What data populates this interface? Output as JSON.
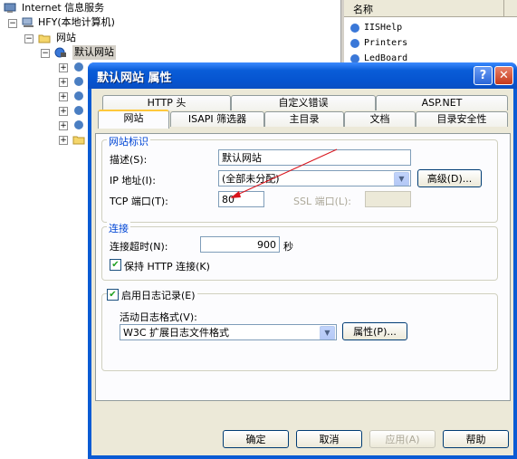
{
  "tree": {
    "root_label": "Internet 信息服务",
    "computer_label": "HFY(本地计算机)",
    "sites_label": "网站",
    "default_site_label": "默认网站"
  },
  "right_pane": {
    "column_name": "名称",
    "items": [
      "IISHelp",
      "Printers",
      "LedBoard"
    ]
  },
  "dialog": {
    "title": "默认网站 属性",
    "help_btn": "?",
    "close_btn": "✕",
    "tabs_row1": [
      "HTTP 头",
      "自定义错误",
      "ASP.NET"
    ],
    "tabs_row2": [
      "网站",
      "ISAPI 筛选器",
      "主目录",
      "文档",
      "目录安全性"
    ],
    "identity": {
      "group_label": "网站标识",
      "desc_label": "描述(S):",
      "desc_value": "默认网站",
      "ip_label": "IP 地址(I):",
      "ip_value": "(全部未分配)",
      "advanced_button": "高级(D)...",
      "tcp_label": "TCP 端口(T):",
      "tcp_value": "80",
      "ssl_label": "SSL 端口(L):",
      "ssl_value": ""
    },
    "connection": {
      "group_label": "连接",
      "timeout_label": "连接超时(N):",
      "timeout_value": "900",
      "timeout_unit": "秒",
      "keepalive_label": "保持 HTTP 连接(K)",
      "keepalive_checked": true
    },
    "logging": {
      "enable_label": "启用日志记录(E)",
      "enable_checked": true,
      "format_label": "活动日志格式(V):",
      "format_value": "W3C 扩展日志文件格式",
      "properties_button": "属性(P)..."
    },
    "buttons": {
      "ok": "确定",
      "cancel": "取消",
      "apply": "应用(A)",
      "help": "帮助"
    }
  }
}
